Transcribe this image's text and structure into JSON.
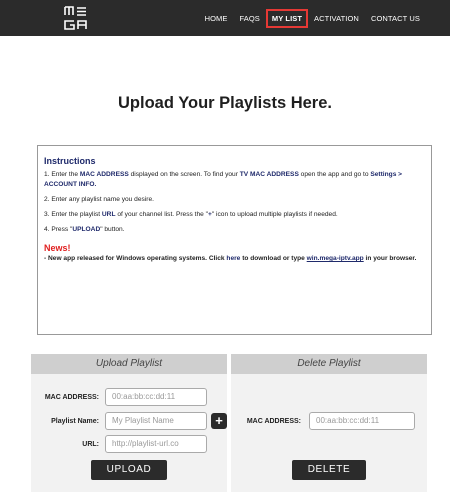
{
  "header": {
    "logo_icon": "mega-logo-icon",
    "nav": [
      {
        "label": "HOME"
      },
      {
        "label": "FAQS"
      },
      {
        "label": "MY LIST",
        "active": true
      },
      {
        "label": "ACTIVATION"
      },
      {
        "label": "CONTACT US"
      }
    ],
    "active_border_color": "#e53935",
    "bar_color": "#2b2b2b"
  },
  "page": {
    "title": "Upload Your Playlists Here."
  },
  "instructions": {
    "title": "Instructions",
    "step1_a": "1. Enter the ",
    "step1_b": "MAC ADDRESS",
    "step1_c": " displayed on the screen. To find your ",
    "step1_d": "TV MAC ADDRESS",
    "step1_e": " open the app and go to ",
    "step1_f": "Settings > ACCOUNT INFO.",
    "step2": "2. Enter any playlist name you desire.",
    "step3_a": "3. Enter the playlist ",
    "step3_b": "URL",
    "step3_c": " of your channel list. Press the \"",
    "step3_d": "+",
    "step3_e": "\" icon to upload multiple playlists if needed.",
    "step4_a": "4. Press \"",
    "step4_b": "UPLOAD",
    "step4_c": "\" button.",
    "news_title": "News!",
    "news_a": "- New app released for Windows operating systems. Click ",
    "news_link": "here",
    "news_b": " to download or type ",
    "news_url": "win.mega-iptv.app",
    "news_c": " in your browser."
  },
  "upload": {
    "title": "Upload Playlist",
    "mac_label": "MAC ADDRESS:",
    "mac_placeholder": "00:aa:bb:cc:dd:11",
    "name_label": "Playlist Name:",
    "name_placeholder": "My Playlist Name",
    "add_icon": "plus-icon",
    "add_symbol": "+",
    "url_label": "URL:",
    "url_placeholder": "http://playlist-url.co",
    "button": "UPLOAD"
  },
  "delete": {
    "title": "Delete Playlist",
    "mac_label": "MAC ADDRESS:",
    "mac_placeholder": "00:aa:bb:cc:dd:11",
    "button": "DELETE"
  }
}
